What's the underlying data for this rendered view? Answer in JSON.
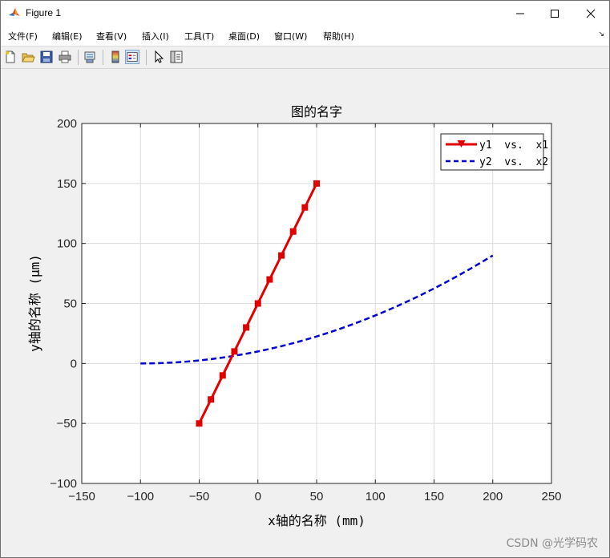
{
  "window": {
    "title": "Figure 1"
  },
  "menu": [
    {
      "label": "文件(F)"
    },
    {
      "label": "编辑(E)"
    },
    {
      "label": "查看(V)"
    },
    {
      "label": "插入(I)"
    },
    {
      "label": "工具(T)"
    },
    {
      "label": "桌面(D)"
    },
    {
      "label": "窗口(W)"
    },
    {
      "label": "帮助(H)"
    }
  ],
  "toolbar": {
    "icons": [
      "new-figure-icon",
      "open-file-icon",
      "save-icon",
      "print-icon",
      "link-plot-icon",
      "colorbar-icon",
      "legend-icon",
      "pointer-icon",
      "property-inspector-icon"
    ]
  },
  "chart_data": {
    "type": "line",
    "title": "图的名字",
    "xlabel": "x轴的名称 (mm)",
    "ylabel": "y轴的名称 (μm)",
    "xlim": [
      -150,
      250
    ],
    "ylim": [
      -100,
      200
    ],
    "xticks": [
      "−150",
      "−100",
      "−50",
      "0",
      "50",
      "100",
      "150",
      "200",
      "250"
    ],
    "yticks": [
      "−100",
      "−50",
      "0",
      "50",
      "100",
      "150",
      "200"
    ],
    "grid": true,
    "legend_position": "top-right",
    "series": [
      {
        "name": "y1  vs.  x1",
        "color": "#e00000",
        "style": "solid-with-markers",
        "x": [
          -50,
          -40,
          -30,
          -20,
          -10,
          0,
          10,
          20,
          30,
          40,
          50
        ],
        "y": [
          -50,
          -30,
          -10,
          10,
          30,
          50,
          70,
          90,
          110,
          130,
          150
        ]
      },
      {
        "name": "y2  vs.  x2",
        "color": "#0000d0",
        "style": "dashed",
        "x": [
          -100,
          -90,
          -80,
          -70,
          -60,
          -50,
          -40,
          -30,
          -20,
          -10,
          0,
          10,
          20,
          30,
          40,
          50,
          60,
          70,
          80,
          90,
          100,
          110,
          120,
          130,
          140,
          150,
          160,
          170,
          180,
          190,
          200
        ],
        "y": [
          0,
          0.1,
          0.4,
          0.9,
          1.6,
          2.5,
          3.6,
          4.9,
          6.4,
          8.1,
          10,
          12.1,
          14.4,
          16.9,
          19.6,
          22.5,
          25.6,
          28.9,
          32.4,
          36.1,
          40,
          44.1,
          48.4,
          52.9,
          57.6,
          62.5,
          67.6,
          72.9,
          78.4,
          84.1,
          90
        ]
      }
    ]
  },
  "watermark": "CSDN @光学码农"
}
